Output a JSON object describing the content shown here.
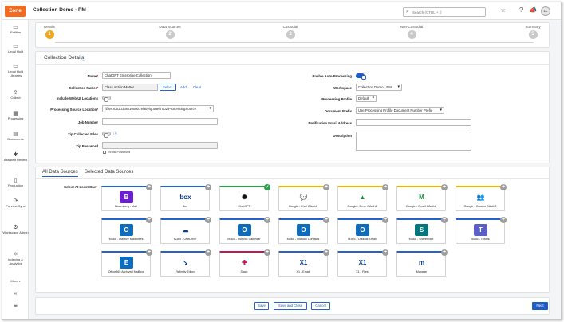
{
  "app": {
    "logo": "Ξone",
    "title": "Collection Demo - PM",
    "search_placeholder": "Search (CTRL + /)",
    "user_initials": "LL"
  },
  "sidebar": {
    "items": [
      {
        "label": "Entities",
        "icon": "entities-icon",
        "glyph": "▭"
      },
      {
        "label": "Legal Hold",
        "icon": "legal-hold-icon",
        "glyph": "▭"
      },
      {
        "label": "Legal Hold Libraries",
        "icon": "library-icon",
        "glyph": "▭"
      },
      {
        "label": "Collect",
        "icon": "collect-icon",
        "glyph": "⇪"
      },
      {
        "label": "Processing",
        "icon": "processing-icon",
        "glyph": "▦"
      },
      {
        "label": "Documents",
        "icon": "documents-icon",
        "glyph": "▤"
      },
      {
        "label": "Assisted Review",
        "icon": "assisted-review-icon",
        "glyph": "✱"
      },
      {
        "label": "Production",
        "icon": "production-icon",
        "glyph": "▯"
      },
      {
        "label": "Purview Sync",
        "icon": "purview-sync-icon",
        "glyph": "⟳"
      },
      {
        "label": "Workspace Admin",
        "icon": "workspace-admin-icon",
        "glyph": "⚙"
      },
      {
        "label": "Indexing & Analytics",
        "icon": "indexing-icon",
        "glyph": "⚛"
      }
    ],
    "more": "More",
    "collapse": "«",
    "menu": "≡"
  },
  "wizard": {
    "steps": [
      {
        "label": "Details",
        "number": "1"
      },
      {
        "label": "Data Sources",
        "number": "2"
      },
      {
        "label": "Custodial",
        "number": "3"
      },
      {
        "label": "Non-Custodial",
        "number": "4"
      },
      {
        "label": "Summary",
        "number": "5"
      }
    ]
  },
  "details": {
    "title": "Collection Details",
    "name_label": "Name",
    "name_value": "ChatGPT Enterprise Collection",
    "matter_label": "Collection Matter",
    "matter_value": "Class Action Matter",
    "select_btn": "Select",
    "add_link": "Add",
    "clear_link": "Clear",
    "web_ui_label": "Include Web UI Locations",
    "psl_label": "Processing Source Location",
    "psl_value": "\\\\files.t002.ctus010000.relativity.one\\T002\\ProcessingSource",
    "job_label": "Job Number",
    "zip_collected_label": "Zip Collected Files",
    "zip_password_label": "Zip Password",
    "show_password": "Show Password",
    "auto_label": "Enable Auto-Processing",
    "workspace_label": "Workspace",
    "workspace_value": "Collection Demo - PM",
    "profile_label": "Processing Profile",
    "profile_value": "Default",
    "prefix_label": "Document Prefix",
    "prefix_value": "Use Processing Profile Document Number Prefix",
    "email_label": "Notification Email Address",
    "description_label": "Description"
  },
  "sources": {
    "tabs": [
      "All Data Sources",
      "Selected Data Sources"
    ],
    "select_label": "Select At Least One",
    "tiles": [
      {
        "name": "Bloomberg - Mail",
        "logo": "B",
        "logo_color": "#6a1fd1",
        "bar": "#2563c9",
        "selected": false,
        "icon": "bloomberg-icon"
      },
      {
        "name": "Box",
        "logo": "box",
        "logo_color": "#ffffff",
        "bar": "#2563c9",
        "selected": false,
        "icon": "box-icon"
      },
      {
        "name": "ChatGPT",
        "logo": "✺",
        "logo_color": "#ffffff",
        "bar": "#2aa04a",
        "selected": true,
        "icon": "chatgpt-icon"
      },
      {
        "name": "Google - Chat OAuth2",
        "logo": "💬",
        "logo_color": "#ffffff",
        "bar": "#f0b400",
        "selected": false,
        "icon": "google-chat-icon"
      },
      {
        "name": "Google - Drive OAuth2",
        "logo": "▲",
        "logo_color": "#ffffff",
        "bar": "#f0b400",
        "selected": false,
        "icon": "google-drive-icon"
      },
      {
        "name": "Google - Gmail OAuth2",
        "logo": "M",
        "logo_color": "#ffffff",
        "bar": "#f0b400",
        "selected": false,
        "icon": "gmail-icon"
      },
      {
        "name": "Google - Groups OAuth2",
        "logo": "👥",
        "logo_color": "#ffffff",
        "bar": "#f0b400",
        "selected": false,
        "icon": "google-groups-icon"
      },
      {
        "name": "M365 - Inactive Mailboxes",
        "logo": "O",
        "logo_color": "#0f6cbd",
        "bar": "#2563c9",
        "selected": false,
        "icon": "m365-inactive-icon"
      },
      {
        "name": "M365 - OneDrive",
        "logo": "☁",
        "logo_color": "#ffffff",
        "bar": "#2563c9",
        "selected": false,
        "icon": "onedrive-icon"
      },
      {
        "name": "M365 - Outlook Calendar",
        "logo": "O",
        "logo_color": "#0f6cbd",
        "bar": "#2563c9",
        "selected": false,
        "icon": "outlook-calendar-icon"
      },
      {
        "name": "M365 - Outlook Contacts",
        "logo": "O",
        "logo_color": "#0f6cbd",
        "bar": "#2563c9",
        "selected": false,
        "icon": "outlook-contacts-icon"
      },
      {
        "name": "M365 - Outlook Email",
        "logo": "O",
        "logo_color": "#0f6cbd",
        "bar": "#2563c9",
        "selected": false,
        "icon": "outlook-email-icon"
      },
      {
        "name": "M365 - SharePoint",
        "logo": "S",
        "logo_color": "#03787c",
        "bar": "#2563c9",
        "selected": false,
        "icon": "sharepoint-icon"
      },
      {
        "name": "M365 - Teams",
        "logo": "T",
        "logo_color": "#5b5fc7",
        "bar": "#2563c9",
        "selected": false,
        "icon": "teams-icon"
      },
      {
        "name": "Office365 Archived Mailbox",
        "logo": "E",
        "logo_color": "#0f6cbd",
        "bar": "#2563c9",
        "selected": false,
        "icon": "exchange-icon"
      },
      {
        "name": "Refinitiv Eikon",
        "logo": "↘",
        "logo_color": "#ffffff",
        "bar": "#2563c9",
        "selected": false,
        "icon": "refinitiv-icon"
      },
      {
        "name": "Slack",
        "logo": "✚",
        "logo_color": "#ffffff",
        "bar": "#c2185b",
        "selected": false,
        "icon": "slack-icon"
      },
      {
        "name": "X1 - Email",
        "logo": "X1",
        "logo_color": "#ffffff",
        "bar": "#2563c9",
        "selected": false,
        "icon": "x1-email-icon"
      },
      {
        "name": "X1 - Files",
        "logo": "X1",
        "logo_color": "#ffffff",
        "bar": "#2563c9",
        "selected": false,
        "icon": "x1-files-icon"
      },
      {
        "name": "iManage",
        "logo": "m",
        "logo_color": "#ffffff",
        "bar": "#2563c9",
        "selected": false,
        "icon": "imanage-icon"
      }
    ]
  },
  "footer": {
    "save": "Save",
    "save_close": "Save and Close",
    "cancel": "Cancel",
    "next": "Next"
  }
}
